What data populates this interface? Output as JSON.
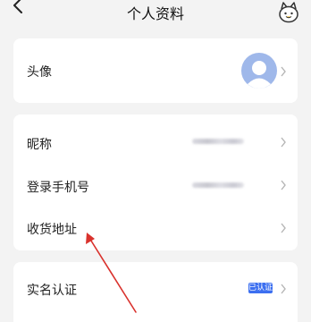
{
  "header": {
    "title": "个人资料",
    "back_icon": "chevron-left-icon",
    "mascot_icon": "mascot-icon"
  },
  "profile": {
    "avatar_label": "头像",
    "nickname_label": "昵称",
    "phone_label": "登录手机号",
    "address_label": "收货地址",
    "verify_label": "实名认证",
    "verify_badge": "已认证"
  },
  "colors": {
    "accent": "#3c6ff0",
    "avatar": "#9fb8ea",
    "annotation": "#d9322d"
  }
}
